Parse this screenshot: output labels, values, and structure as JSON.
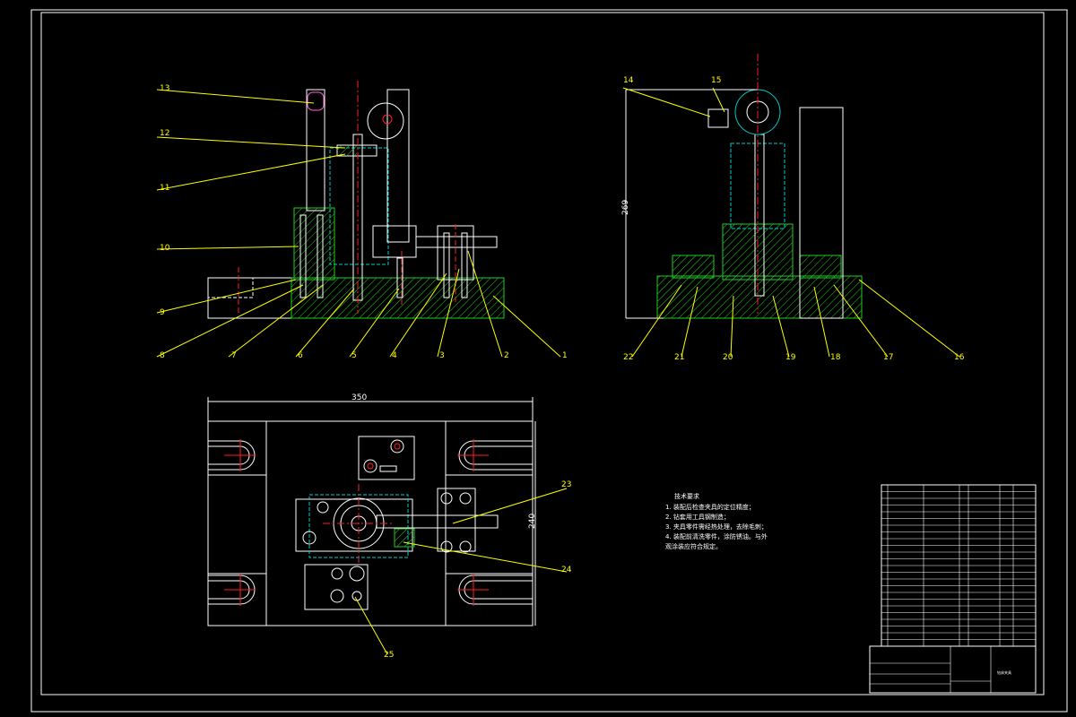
{
  "colors": {
    "background": "#000000",
    "outline": "#ffffff",
    "centerline": "#ff2020",
    "hatch": "#22cc22",
    "hidden": "#00cccc",
    "leader": "#ffff00",
    "part": "#ff66cc"
  },
  "front_view": {
    "labels": [
      "13",
      "12",
      "11",
      "10",
      "9",
      "8",
      "7",
      "6",
      "5",
      "4",
      "3",
      "2",
      "1"
    ]
  },
  "side_view": {
    "labels": [
      "14",
      "15",
      "22",
      "21",
      "20",
      "19",
      "18",
      "17",
      "16"
    ],
    "height_dim": "269"
  },
  "top_view": {
    "width_dim": "350",
    "height_dim": "240",
    "labels": [
      "23",
      "24",
      "25"
    ]
  },
  "notes": {
    "title": "技术要求",
    "lines": [
      "1. 装配后检查夹具的定位精度；",
      "2. 钻套用工具钢制造；",
      "3. 夹具零件需经热处理，去除毛刺；",
      "4. 装配前清洗零件，涂防锈油。与外",
      "观涂装应符合规定。"
    ]
  },
  "title_block": {
    "rows": 24,
    "title": "钻床夹具"
  }
}
